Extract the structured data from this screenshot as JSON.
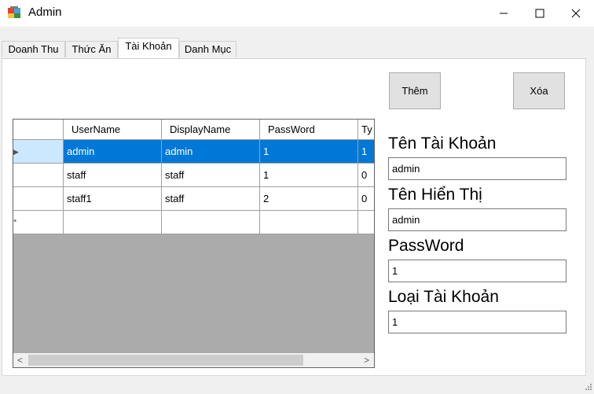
{
  "window": {
    "title": "Admin",
    "minimize": "—",
    "maximize": "☐",
    "close": "✕"
  },
  "tabs": [
    {
      "label": "Doanh Thu"
    },
    {
      "label": "Thức Ăn"
    },
    {
      "label": "Tài Khoản"
    },
    {
      "label": "Danh Mục"
    }
  ],
  "toolbar": {
    "add_label": "Thêm",
    "delete_label": "Xóa"
  },
  "grid": {
    "columns": [
      "UserName",
      "DisplayName",
      "PassWord",
      "Ty"
    ],
    "rows": [
      [
        "admin",
        "admin",
        "1",
        "1"
      ],
      [
        "staff",
        "staff",
        "1",
        "0"
      ],
      [
        "staff1",
        "staff",
        "2",
        "0"
      ]
    ],
    "current_row_marker": "▶",
    "new_row_marker": "*",
    "scroll_left": "<",
    "scroll_right": ">"
  },
  "form": {
    "username_label": "Tên Tài Khoản",
    "username_value": "admin",
    "displayname_label": "Tên Hiển Thị",
    "displayname_value": "admin",
    "password_label": "PassWord",
    "password_value": "1",
    "type_label": "Loại Tài Khoản",
    "type_value": "1"
  }
}
